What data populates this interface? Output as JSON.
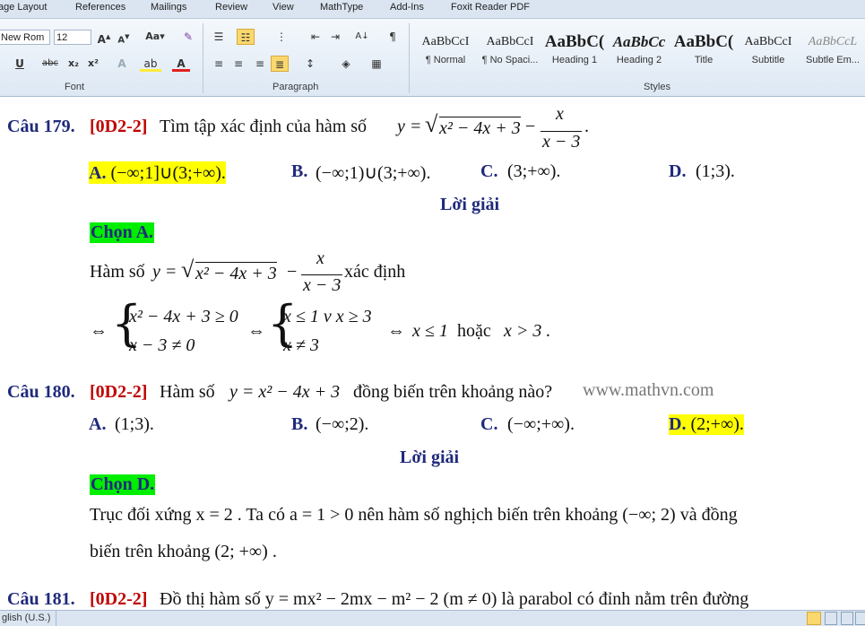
{
  "ribbon": {
    "tabs": [
      "age Layout",
      "References",
      "Mailings",
      "Review",
      "View",
      "MathType",
      "Add-Ins",
      "Foxit Reader PDF"
    ],
    "font_name": "New Rom",
    "font_size": "12",
    "group_labels": {
      "font": "Font",
      "paragraph": "Paragraph",
      "styles": "Styles"
    },
    "styles": [
      {
        "sample": "AaBbCcI",
        "name": "¶ Normal"
      },
      {
        "sample": "AaBbCcI",
        "name": "¶ No Spaci..."
      },
      {
        "sample": "AaBbC(",
        "name": "Heading 1"
      },
      {
        "sample": "AaBbCc",
        "name": "Heading 2"
      },
      {
        "sample": "AaBbC(",
        "name": "Title"
      },
      {
        "sample": "AaBbCcI",
        "name": "Subtitle"
      },
      {
        "sample": "AaBbCcL",
        "name": "Subtle Em..."
      }
    ]
  },
  "doc": {
    "q179": {
      "label": "Câu 179.",
      "code": "[0D2-2]",
      "text": "Tìm tập xác định của hàm số",
      "lhs": "y =",
      "rad": "x² − 4x + 3",
      "frac_num": "x",
      "frac_den": "x − 3",
      "a_label": "A.",
      "a_val": "(−∞;1]∪(3;+∞).",
      "b_label": "B.",
      "b_val": "(−∞;1)∪(3;+∞).",
      "c_label": "C.",
      "c_val": "(3;+∞).",
      "d_label": "D.",
      "d_val": "(1;3).",
      "solution": "Lời giải",
      "choice": "Chọn A.",
      "line1_text": "Hàm số",
      "line1_end": "xác định",
      "sys1_r1": "x² − 4x + 3 ≥ 0",
      "sys1_r2": "x − 3 ≠ 0",
      "sys2_r1": "x ≤ 1 v x ≥ 3",
      "sys2_r2": "x ≠ 3",
      "iff": "⇔",
      "conclusion": "x ≤ 1",
      "or": "hoặc",
      "conclusion2": "x > 3 ."
    },
    "q180": {
      "label": "Câu 180.",
      "code": "[0D2-2]",
      "text1": "Hàm số",
      "func": "y = x² − 4x + 3",
      "text2": "đồng biến trên khoảng nào?",
      "watermark": "www.mathvn.com",
      "a_label": "A.",
      "a_val": "(1;3).",
      "b_label": "B.",
      "b_val": "(−∞;2).",
      "c_label": "C.",
      "c_val": "(−∞;+∞).",
      "d_label": "D.",
      "d_val": "(2;+∞).",
      "solution": "Lời giải",
      "choice": "Chọn D.",
      "expl1": "Trục đối xứng  x = 2 . Ta có  a = 1 > 0  nên hàm số nghịch biến trên khoảng  (−∞; 2)  và đồng",
      "expl2": "biến trên khoảng  (2; +∞) ."
    },
    "q181": {
      "label": "Câu 181.",
      "code": "[0D2-2]",
      "text": "Đồ thị hàm số  y = mx² − 2mx − m² − 2  (m ≠ 0)  là parabol có đỉnh nằm trên đường"
    }
  },
  "status": {
    "language": "glish (U.S.)"
  }
}
